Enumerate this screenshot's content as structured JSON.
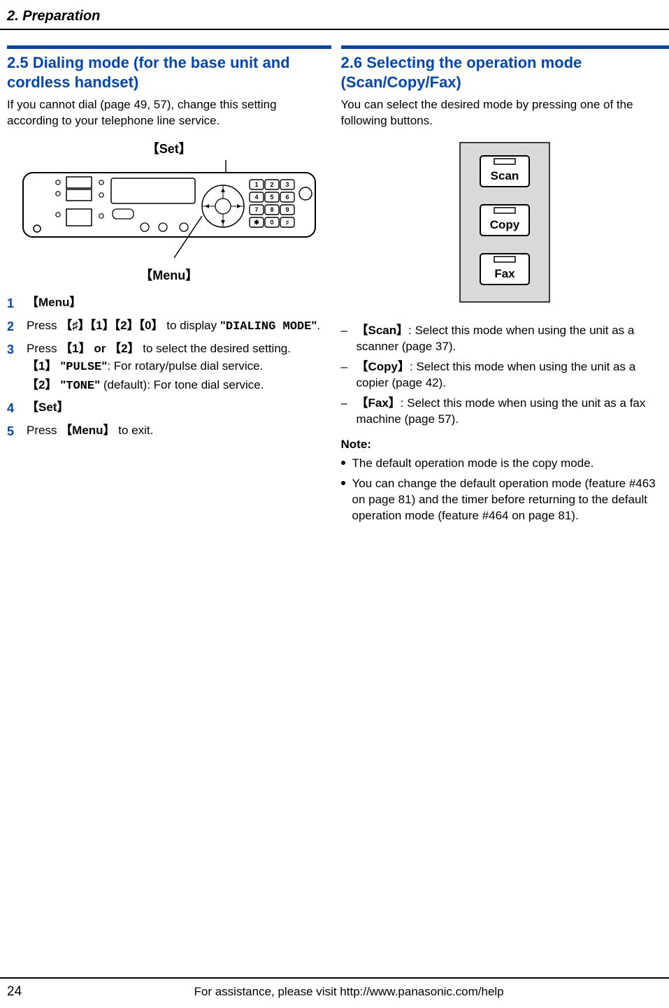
{
  "header": {
    "chapter": "2. Preparation"
  },
  "left": {
    "heading": "2.5 Dialing mode (for the base unit and cordless handset)",
    "intro": "If you cannot dial (page 49, 57), change this setting according to your telephone line service.",
    "callout_set": "【Set】",
    "callout_menu": "【Menu】",
    "steps": {
      "s1": {
        "label": "【Menu】"
      },
      "s2": {
        "prefix": "Press ",
        "keys": "【♯】【1】【2】【0】",
        "mid": " to display ",
        "quote_open": "\"",
        "code": "DIALING MODE",
        "quote_close": "\"",
        "suffix": "."
      },
      "s3": {
        "line1_prefix": "Press ",
        "line1_keys": "【1】 or 【2】",
        "line1_suffix": " to select the desired setting.",
        "opt1_key": "【1】 ",
        "opt1_q1": "\"",
        "opt1_code": "PULSE",
        "opt1_q2": "\"",
        "opt1_rest": ": For rotary/pulse dial service.",
        "opt2_key": "【2】 ",
        "opt2_q1": "\"",
        "opt2_code": "TONE",
        "opt2_q2": "\"",
        "opt2_rest": " (default): For tone dial service."
      },
      "s4": {
        "label": "【Set】"
      },
      "s5": {
        "prefix": "Press ",
        "key": "【Menu】",
        "suffix": " to exit."
      }
    }
  },
  "right": {
    "heading": "2.6 Selecting the operation mode (Scan/Copy/Fax)",
    "intro": "You can select the desired mode by pressing one of the following buttons.",
    "buttons": {
      "scan": "Scan",
      "copy": "Copy",
      "fax": "Fax"
    },
    "modes": {
      "scan_key": "【Scan】",
      "scan_text": ": Select this mode when using the unit as a scanner (page 37).",
      "copy_key": "【Copy】",
      "copy_text": ": Select this mode when using the unit as a copier (page 42).",
      "fax_key": "【Fax】",
      "fax_text": ": Select this mode when using the unit as a fax machine (page 57)."
    },
    "note_label": "Note:",
    "notes": {
      "n1": "The default operation mode is the copy mode.",
      "n2": "You can change the default operation mode (feature #463 on page 81) and the timer before returning to the default operation mode (feature #464 on page 81)."
    }
  },
  "footer": {
    "page": "24",
    "text": "For assistance, please visit http://www.panasonic.com/help"
  }
}
